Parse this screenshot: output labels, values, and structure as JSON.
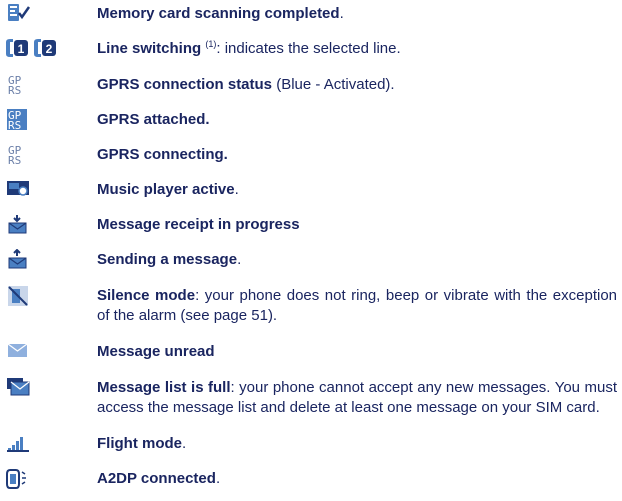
{
  "items": [
    {
      "bold": "Memory card scanning completed",
      "rest": "."
    },
    {
      "bold": "Line switching",
      "sup": "(1)",
      "rest": ": indicates the selected line."
    },
    {
      "bold": "GPRS connection status",
      "rest": " (Blue - Activated)."
    },
    {
      "bold": "GPRS attached.",
      "rest": ""
    },
    {
      "bold": "GPRS connecting.",
      "rest": ""
    },
    {
      "bold": "Music player active",
      "rest": "."
    },
    {
      "bold": "Message receipt in progress",
      "rest": ""
    },
    {
      "bold": "Sending a message",
      "rest": "."
    },
    {
      "bold": "Silence mode",
      "rest": ": your phone does not ring, beep or vibrate with the exception of the alarm (see page 51)."
    },
    {
      "bold": "Message unread",
      "rest": ""
    },
    {
      "bold": "Message list is full",
      "rest": ": your phone cannot accept any new messages. You must access the message list and delete at least one message on your SIM card."
    },
    {
      "bold": "Flight mode",
      "rest": "."
    },
    {
      "bold": "A2DP connected",
      "rest": "."
    }
  ],
  "icons": {
    "memory": "GPRS icon label",
    "gprs_text_top": "GP",
    "gprs_text_bottom": "RS"
  },
  "colors": {
    "text": "#1a2560",
    "icon_blue": "#4a7fc2",
    "icon_dark": "#1f3a78"
  }
}
